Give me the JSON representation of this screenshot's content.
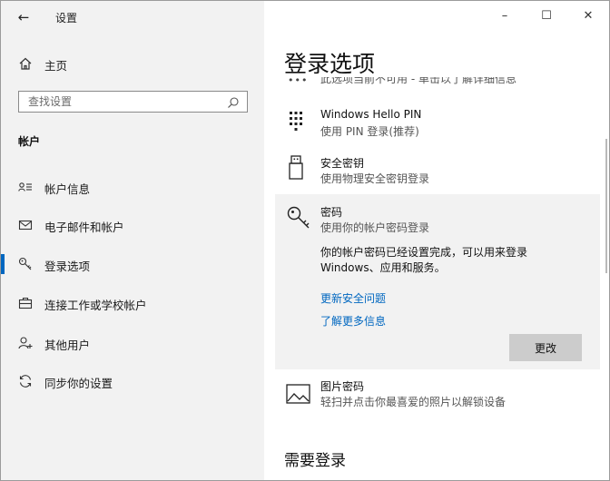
{
  "window": {
    "title": "设置"
  },
  "titlebar": {
    "minimize": "–",
    "maximize": "☐",
    "close": "✕"
  },
  "sidebar": {
    "back": "←",
    "home_label": "主页",
    "search_placeholder": "查找设置",
    "section": "帐户",
    "items": [
      {
        "label": "帐户信息",
        "icon": "person-card-icon",
        "selected": false
      },
      {
        "label": "电子邮件和帐户",
        "icon": "mail-icon",
        "selected": false
      },
      {
        "label": "登录选项",
        "icon": "key-icon",
        "selected": true
      },
      {
        "label": "连接工作或学校帐户",
        "icon": "briefcase-icon",
        "selected": false
      },
      {
        "label": "其他用户",
        "icon": "person-add-icon",
        "selected": false
      },
      {
        "label": "同步你的设置",
        "icon": "sync-icon",
        "selected": false
      }
    ]
  },
  "main": {
    "title": "登录选项",
    "cut_text": "此选项当前不可用 - 单击以了解详细信息",
    "options": [
      {
        "title": "Windows Hello PIN",
        "subtitle": "使用 PIN 登录(推荐)",
        "icon": "pin-keypad-icon"
      },
      {
        "title": "安全密钥",
        "subtitle": "使用物理安全密钥登录",
        "icon": "usb-key-icon"
      },
      {
        "title": "密码",
        "subtitle": "使用你的帐户密码登录",
        "icon": "password-key-icon"
      },
      {
        "title": "图片密码",
        "subtitle": "轻扫并点击你最喜爱的照片以解锁设备",
        "icon": "picture-icon"
      }
    ],
    "expanded": {
      "description": "你的帐户密码已经设置完成，可以用来登录 Windows、应用和服务。",
      "link_update": "更新安全问题",
      "link_learn": "了解更多信息",
      "button": "更改"
    },
    "require_heading": "需要登录"
  },
  "colors": {
    "accent": "#0067c0",
    "sidebar_bg": "#f2f2f2",
    "expanded_bg": "#f2f2f2",
    "button_bg": "#cccccc"
  }
}
